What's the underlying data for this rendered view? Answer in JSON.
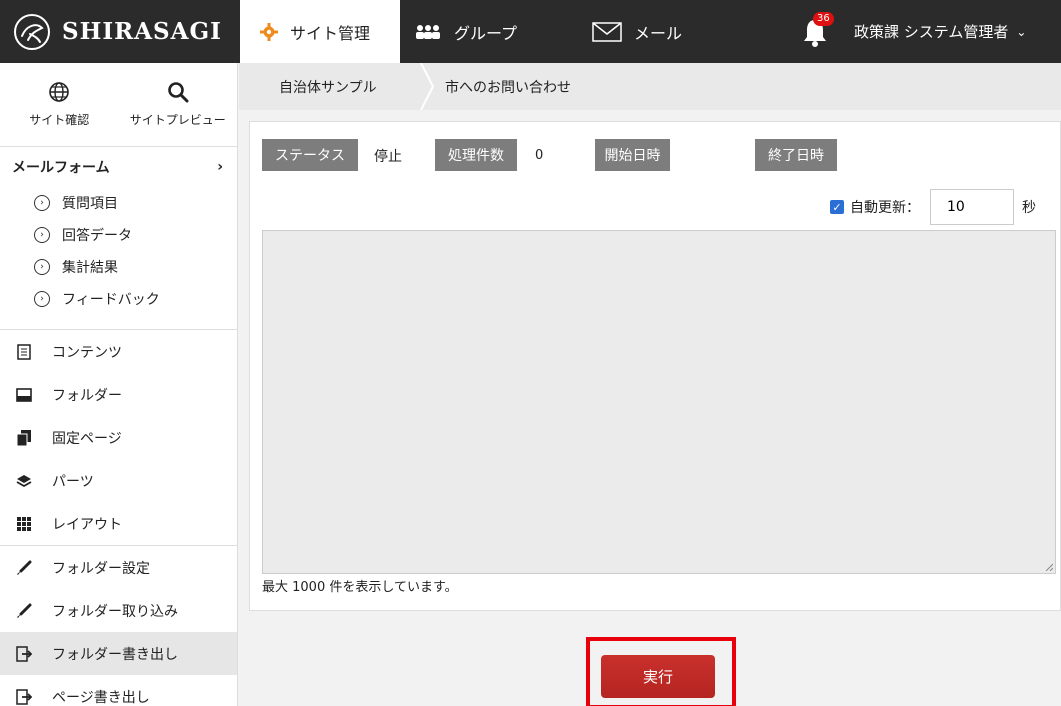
{
  "header": {
    "logo_text": "SHIRASAGI",
    "nav": {
      "site": "サイト管理",
      "group": "グループ",
      "mail": "メール"
    },
    "notification_count": "36",
    "user": "政策課 システム管理者"
  },
  "sidebar": {
    "top": {
      "site_check": "サイト確認",
      "site_preview": "サイトプレビュー"
    },
    "form_title": "メールフォーム",
    "form_items": [
      "質問項目",
      "回答データ",
      "集計結果",
      "フィードバック"
    ],
    "menu": [
      "コンテンツ",
      "フォルダー",
      "固定ページ",
      "パーツ",
      "レイアウト"
    ],
    "tools": [
      "フォルダー設定",
      "フォルダー取り込み",
      "フォルダー書き出し",
      "ページ書き出し"
    ]
  },
  "breadcrumb": [
    "自治体サンプル",
    "市へのお問い合わせ"
  ],
  "status": {
    "status_label": "ステータス",
    "status_value": "停止",
    "count_label": "処理件数",
    "count_value": "0",
    "start_label": "開始日時",
    "end_label": "終了日時",
    "auto_label": "自動更新：",
    "auto_value": "10",
    "auto_unit": "秒",
    "note": "最大 1000 件を表示しています。"
  },
  "run_label": "実行",
  "colors": {
    "header_bg": "#2b2b2b",
    "label_bg": "#7d7d7d",
    "run_btn": "#c9302c",
    "highlight_frame": "#e8000b"
  }
}
